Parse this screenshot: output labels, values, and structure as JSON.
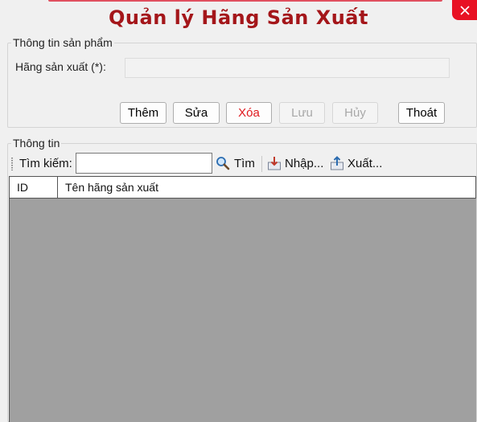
{
  "window": {
    "title": "Quản lý Hãng Sản Xuất",
    "close_icon": "close-icon",
    "accent_color": "#a4161a",
    "close_color": "#e81123"
  },
  "product_group": {
    "legend": "Thông tin sản phẩm",
    "manufacturer_label": "Hãng sản xuất (*):",
    "manufacturer_value": ""
  },
  "actions": {
    "add": "Thêm",
    "edit": "Sửa",
    "delete": "Xóa",
    "save": "Lưu",
    "cancel": "Hủy",
    "exit": "Thoát"
  },
  "info_group": {
    "legend": "Thông tin"
  },
  "toolbar": {
    "search_label": "Tìm kiếm:",
    "search_value": "",
    "find_label": "Tìm",
    "find_icon": "magnifier-icon",
    "import_label": "Nhập...",
    "import_icon": "import-icon",
    "export_label": "Xuất...",
    "export_icon": "export-icon"
  },
  "table": {
    "columns": [
      "ID",
      "Tên hãng sản xuất"
    ],
    "rows": []
  }
}
